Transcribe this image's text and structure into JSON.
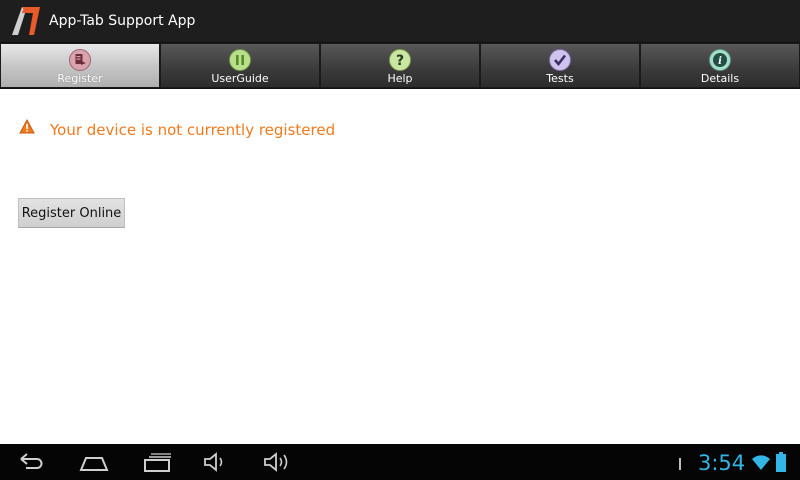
{
  "app": {
    "title": "App-Tab Support App"
  },
  "tabs": [
    {
      "label": "Register",
      "icon": "register-icon",
      "active": true
    },
    {
      "label": "UserGuide",
      "icon": "pause-icon",
      "active": false
    },
    {
      "label": "Help",
      "icon": "help-icon",
      "active": false
    },
    {
      "label": "Tests",
      "icon": "check-icon",
      "active": false
    },
    {
      "label": "Details",
      "icon": "info-icon",
      "active": false
    }
  ],
  "content": {
    "message": "Your device is not currently registered",
    "register_button_label": "Register Online"
  },
  "statusbar": {
    "time": "3:54",
    "nav_icons": [
      "back-icon",
      "home-icon",
      "recent-apps-icon",
      "volume-down-icon",
      "volume-up-icon"
    ],
    "status_icons": [
      "wifi-icon",
      "battery-icon"
    ]
  },
  "colors": {
    "accent_orange": "#f07a1e",
    "clock_blue": "#33b5e5"
  }
}
